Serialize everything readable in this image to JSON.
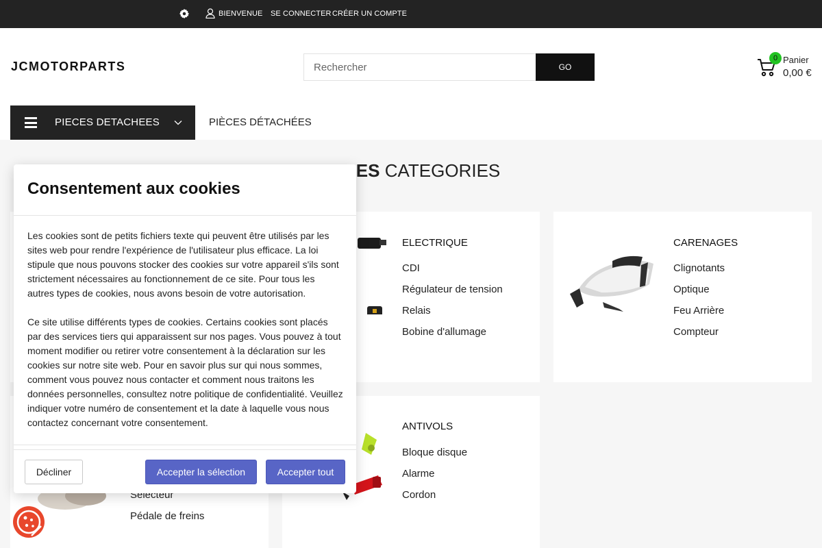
{
  "topbar": {
    "welcome": "BIENVENUE",
    "login": "SE CONNECTER",
    "register": "CRÉER UN COMPTE"
  },
  "header": {
    "logo": "JCMOTORPARTS",
    "search_placeholder": "Rechercher",
    "search_button": "GO",
    "cart_count": "0",
    "cart_label": "Panier",
    "cart_total": "0,00 €"
  },
  "nav": {
    "menu_label": "PIECES DETACHEES",
    "link": "PIÈCES DÉTACHÉES"
  },
  "main": {
    "section_title_bold": "PALES",
    "section_title_rest": " CATEGORIES",
    "cards": [
      {
        "title": "ELECTRIQUE",
        "items": [
          "CDI",
          "Régulateur de tension",
          "Relais",
          "Bobine d'allumage"
        ]
      },
      {
        "title": "CARENAGES",
        "items": [
          "Clignotants",
          "Optique",
          "Feu Arrière",
          "Compteur"
        ]
      },
      {
        "title": "ANTIVOLS",
        "items": [
          "Bloque disque",
          "Alarme",
          "Cordon"
        ]
      },
      {
        "items": [
          "Sélecteur",
          "Pédale de freins"
        ]
      }
    ]
  },
  "cookie_modal": {
    "title": "Consentement aux cookies",
    "paragraph1": "Les cookies sont de petits fichiers texte qui peuvent être utilisés par les sites web pour rendre l'expérience de l'utilisateur plus efficace. La loi stipule que nous pouvons stocker des cookies sur votre appareil s'ils sont strictement nécessaires au fonctionnement de ce site. Pour tous les autres types de cookies, nous avons besoin de votre autorisation.",
    "paragraph2": "Ce site utilise différents types de cookies. Certains cookies sont placés par des services tiers qui apparaissent sur nos pages. Vous pouvez à tout moment modifier ou retirer votre consentement à la déclaration sur les cookies sur notre site web. Pour en savoir plus sur qui nous sommes, comment vous pouvez nous contacter et comment nous traitons les données personnelles, consultez notre politique de confidentialité. Veuillez indiquer votre numéro de consentement et la date à laquelle vous nous contactez concernant votre consentement.",
    "decline": "Décliner",
    "accept_selection": "Accepter la sélection",
    "accept_all": "Accepter tout"
  },
  "colors": {
    "topbar_bg": "#232323",
    "accent_button": "#5865c6",
    "cart_badge": "#22c322",
    "cookie_fab": "#e8472c"
  },
  "icons": [
    "gear-icon",
    "user-icon",
    "cart-icon",
    "hamburger-icon",
    "chevron-down-icon",
    "cookie-icon"
  ]
}
